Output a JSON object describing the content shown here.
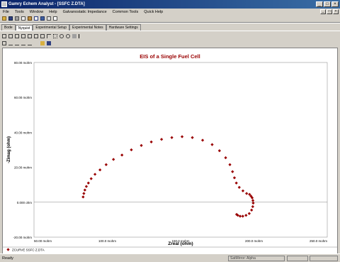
{
  "window": {
    "title": "Gamry Echem Analyst - [SSFC Z.DTA]",
    "controls": [
      "_",
      "□",
      "×"
    ]
  },
  "menu": {
    "items": [
      "File",
      "Tools",
      "Window",
      "Help",
      "Galvanostatic Impedance",
      "Common Tools",
      "Quick Help"
    ],
    "mdi_controls": [
      "_",
      "□",
      "×"
    ]
  },
  "tabs": {
    "items": [
      "Bode",
      "Nyquist",
      "Experimental Setup",
      "Experimental Notes",
      "Hardware Settings"
    ],
    "active": "Nyquist"
  },
  "status": {
    "text": "Ready",
    "task": "SatMirror: Alpha"
  },
  "chart_data": {
    "type": "scatter",
    "title": "EIS of a Single Fuel Cell",
    "xlabel": "Zreal (ohm)",
    "ylabel": "-Zimag (ohm)",
    "xlim": [
      50,
      250
    ],
    "ylim": [
      -20,
      80
    ],
    "x_ticks": [
      "50.00 mohm",
      "100.0 mohm",
      "150.0 mohm",
      "200.0 mohm",
      "250.0 mohm"
    ],
    "y_ticks": [
      "80.00 mohm",
      "60.00 mohm",
      "40.00 mohm",
      "20.00 mohm",
      "0.000 ohm",
      "-20.00 mohm"
    ],
    "x_tick_values": [
      50,
      100,
      150,
      200,
      250
    ],
    "y_tick_values": [
      80,
      60,
      40,
      20,
      0,
      -20
    ],
    "grid": false,
    "zero_line": true,
    "legend_position": "bottom-left",
    "series": [
      {
        "name": "ZCURVE SSFC Z.DTA",
        "color": "#990000",
        "x": [
          83.5,
          84.0,
          84.7,
          85.7,
          87.1,
          89.0,
          91.6,
          95.0,
          99.2,
          104.2,
          110.0,
          116.4,
          123.2,
          130.0,
          137.0,
          144.0,
          151.0,
          158.0,
          165.0,
          171.5,
          176.5,
          180.7,
          183.6,
          185.4,
          186.7,
          188.0,
          190.0,
          192.5,
          195.0,
          197.0,
          198.0,
          198.8,
          199.3,
          199.5,
          199.2,
          198.4,
          196.8,
          194.6,
          192.4,
          190.6,
          189.0,
          188.2
        ],
        "y": [
          3.0,
          5.0,
          7.0,
          9.0,
          11.0,
          13.5,
          16.0,
          18.5,
          21.5,
          24.5,
          27.0,
          30.0,
          32.5,
          34.5,
          36.0,
          37.0,
          37.5,
          37.0,
          35.5,
          33.0,
          29.5,
          25.5,
          21.5,
          17.5,
          14.0,
          11.0,
          8.5,
          6.5,
          5.0,
          4.5,
          3.5,
          2.5,
          1.0,
          -0.5,
          -2.5,
          -4.5,
          -6.5,
          -7.5,
          -8.0,
          -8.0,
          -7.5,
          -7.0
        ]
      }
    ]
  }
}
